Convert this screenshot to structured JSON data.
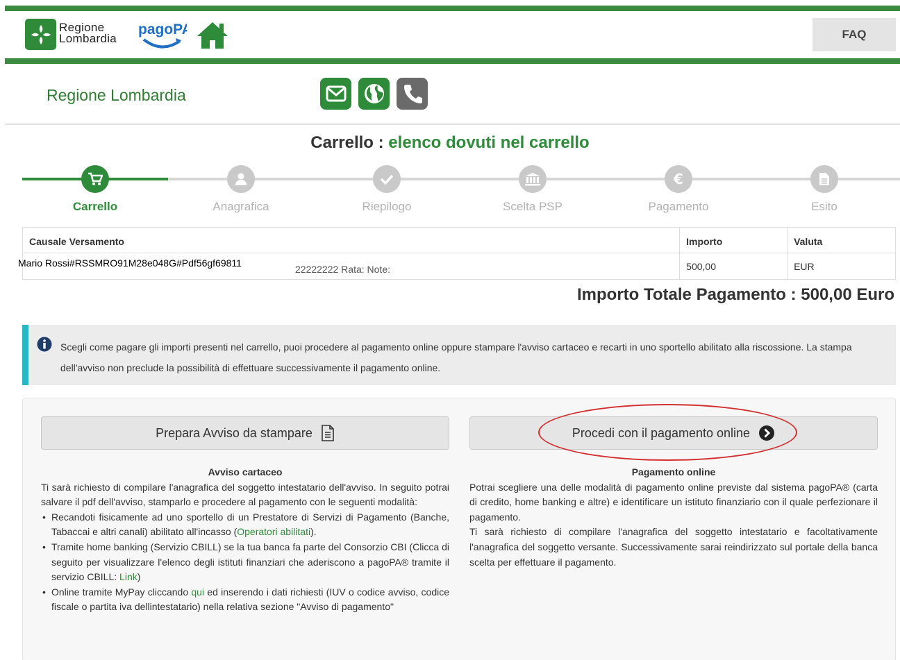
{
  "header": {
    "logo_line1": "Regione",
    "logo_line2": "Lombardia",
    "pagopa_logo": "pagoPA",
    "home_icon": "home-icon",
    "faq_label": "FAQ",
    "brand_color": "#3a8a3f"
  },
  "site": {
    "title": "Regione Lombardia",
    "icons": [
      "envelope-icon",
      "globe-icon",
      "phone-icon"
    ]
  },
  "page": {
    "title_prefix": "Carrello : ",
    "title_accent": "elenco dovuti nel carrello"
  },
  "stepper": {
    "steps": [
      {
        "label": "Carrello",
        "icon": "cart-icon",
        "active": true
      },
      {
        "label": "Anagrafica",
        "icon": "user-icon",
        "active": false
      },
      {
        "label": "Riepilogo",
        "icon": "check-icon",
        "active": false
      },
      {
        "label": "Scelta PSP",
        "icon": "bank-icon",
        "active": false
      },
      {
        "label": "Pagamento",
        "icon": "euro-icon",
        "active": false
      },
      {
        "label": "Esito",
        "icon": "document-icon",
        "active": false
      }
    ]
  },
  "cart": {
    "columns": [
      "Causale Versamento",
      "Importo",
      "Valuta"
    ],
    "rows": [
      {
        "causale": "Mario Rossi#RSSMRO91M28e048G#Pdf56gf69811",
        "causale_tail": "22222222 Rata: Note:",
        "importo": "500,00",
        "valuta": "EUR"
      }
    ]
  },
  "totale": "Importo Totale Pagamento : 500,00 Euro",
  "info": {
    "text": "Scegli come pagare gli importi presenti nel carrello, puoi procedere al pagamento online oppure stampare l'avviso cartaceo e recarti in uno sportello abilitato alla riscossione. La stampa dell'avviso non preclude la possibilità di effettuare successivamente il pagamento online."
  },
  "avviso": {
    "button_label": "Prepara Avviso da stampare",
    "heading": "Avviso cartaceo",
    "intro": "Ti sarà richiesto di compilare l'anagrafica del soggetto intestatario dell'avviso. In seguito potrai salvare il pdf dell'avviso, stamparlo e procedere al pagamento con le seguenti modalità:",
    "b1_text": "Recandoti fisicamente ad uno sportello di un Prestatore di Servizi di Pagamento (Banche, Tabaccai e altri canali) abilitato all'incasso (",
    "b1_link": "Operatori abilitati",
    "b1_end": ").",
    "b2_text": "Tramite home banking (Servizio CBILL) se la tua banca fa parte del Consorzio CBI (Clicca di seguito per visualizzare l'elenco degli istituti finanziari che aderiscono a pagoPA® tramite il servizio CBILL: ",
    "b2_link": "Link",
    "b2_end": ")",
    "b3_text": "Online tramite MyPay cliccando ",
    "b3_link": "qui",
    "b3_end": " ed inserendo i dati richiesti (IUV o codice avviso, codice fiscale o partita iva dellintestatario) nella relativa sezione \"Avviso di pagamento\""
  },
  "online": {
    "button_label": "Procedi con il pagamento online",
    "heading": "Pagamento online",
    "p1": "Potrai scegliere una delle modalità di pagamento online previste dal sistema pagoPA® (carta di credito, home banking e altre) e identificare un istituto finanziario con il quale perfezionare il pagamento.",
    "p2": "Ti sarà richiesto di compilare l'anagrafica del soggetto intestatario e facoltativamente l'anagrafica del soggetto versante. Successivamente sarai reindirizzato sul portale della banca scelta per effettuare il pagamento."
  }
}
